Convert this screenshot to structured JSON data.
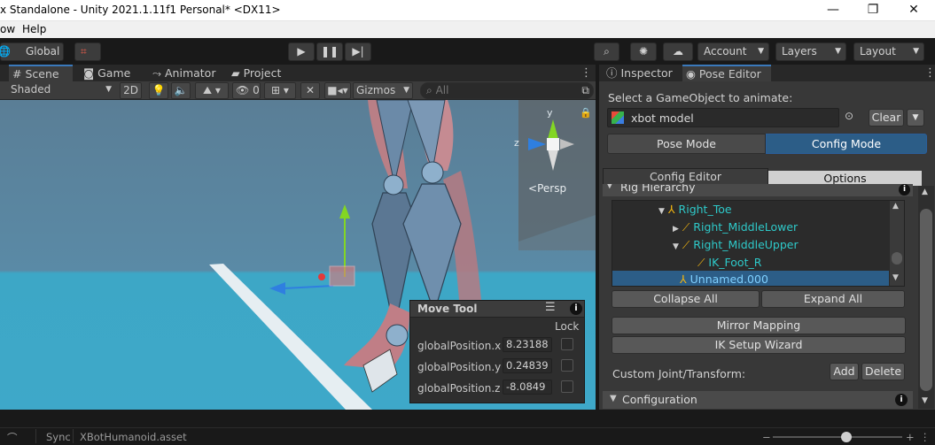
{
  "window": {
    "title": "x Standalone - Unity 2021.1.11f1 Personal* <DX11>",
    "minimize_glyph": "—",
    "restore_glyph": "❐",
    "close_glyph": "✕"
  },
  "menubar": {
    "items": [
      "ow",
      "Help"
    ]
  },
  "toolbar": {
    "global_label": "Global",
    "account_label": "Account",
    "layers_label": "Layers",
    "layout_label": "Layout"
  },
  "scene": {
    "tabs": [
      {
        "label": "Scene"
      },
      {
        "label": "Game"
      },
      {
        "label": "Animator"
      },
      {
        "label": "Project"
      }
    ],
    "shading_mode": "Shaded",
    "toggle_2d": "2D",
    "hidden_count": "0",
    "gizmos_label": "Gizmos",
    "search_placeholder": "All",
    "persp_label": "Persp",
    "axis_y": "y",
    "axis_z": "z"
  },
  "move_tool": {
    "title": "Move Tool",
    "lock_label": "Lock",
    "fields": [
      {
        "label": "globalPosition.x",
        "value": "8.23188"
      },
      {
        "label": "globalPosition.y",
        "value": "0.24839"
      },
      {
        "label": "globalPosition.z",
        "value": "-8.0849"
      }
    ]
  },
  "right": {
    "tabs": [
      {
        "label": "Inspector"
      },
      {
        "label": "Pose Editor"
      }
    ],
    "select_prompt": "Select a GameObject to animate:",
    "object_field": "xbot model",
    "clear_button": "Clear",
    "modes": [
      "Pose Mode",
      "Config Mode"
    ],
    "subtabs": [
      "Config Editor",
      "Options"
    ],
    "rig_hierarchy_title": "Rig Hierarchy",
    "tree": [
      {
        "label": "Right_Toe"
      },
      {
        "label": "Right_MiddleLower"
      },
      {
        "label": "Right_MiddleUpper"
      },
      {
        "label": "IK_Foot_R"
      },
      {
        "label": "Unnamed.000"
      }
    ],
    "collapse_all": "Collapse All",
    "expand_all": "Expand All",
    "mirror_mapping": "Mirror Mapping",
    "ik_setup_wizard": "IK Setup Wizard",
    "custom_joint_label": "Custom Joint/Transform:",
    "add_button": "Add",
    "delete_button": "Delete",
    "configuration_title": "Configuration"
  },
  "status": {
    "sync_label": "Sync",
    "asset_label": "XBotHumanoid.asset"
  },
  "colors": {
    "accent": "#3a79bb",
    "selected_row": "#2c5d87",
    "tree_text": "#2ec9c9",
    "sky": "#41a6c4"
  }
}
